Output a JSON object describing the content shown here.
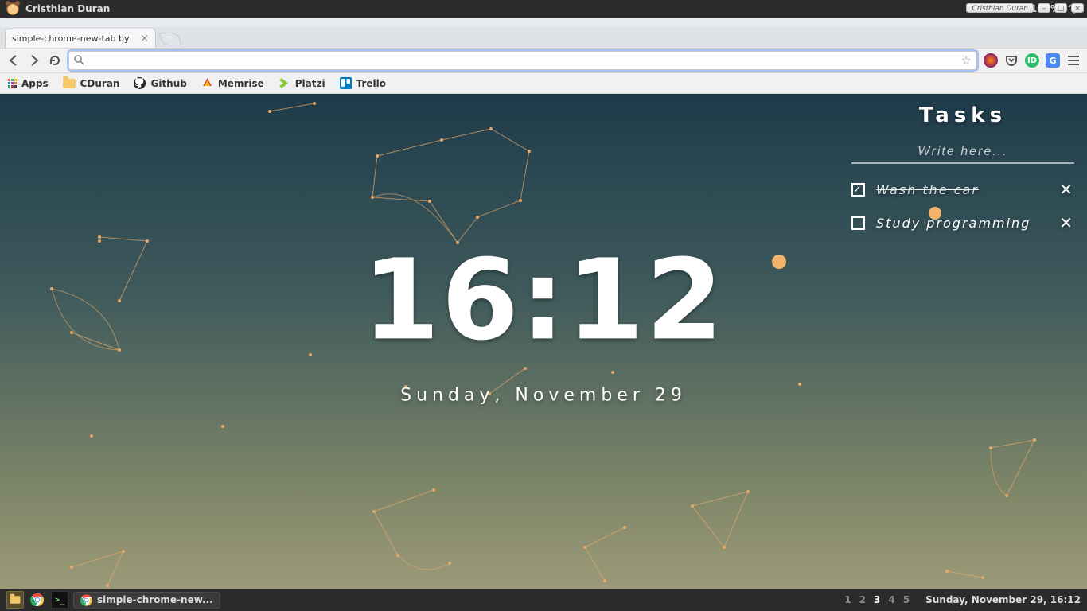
{
  "system": {
    "top": {
      "user_label": "Cristhian Duran",
      "battery": "100%"
    },
    "bottom": {
      "task_button": "simple-chrome-new...",
      "workspaces": [
        "1",
        "2",
        "3",
        "4",
        "5"
      ],
      "active_workspace": 2,
      "datetime": "Sunday, November 29, 16:12"
    }
  },
  "browser": {
    "window_caption": "Cristhian Duran",
    "tab_title": "simple-chrome-new-tab by",
    "url_value": "",
    "bookmarks": [
      {
        "label": "Apps"
      },
      {
        "label": "CDuran"
      },
      {
        "label": "Github"
      },
      {
        "label": "Memrise"
      },
      {
        "label": "Platzi"
      },
      {
        "label": "Trello"
      }
    ]
  },
  "page": {
    "time": "16:12",
    "date": "Sunday, November 29",
    "tasks_header": "Tasks",
    "tasks_placeholder": "Write here...",
    "tasks": [
      {
        "text": "Wash the car",
        "done": true
      },
      {
        "text": "Study programming",
        "done": false
      }
    ]
  }
}
